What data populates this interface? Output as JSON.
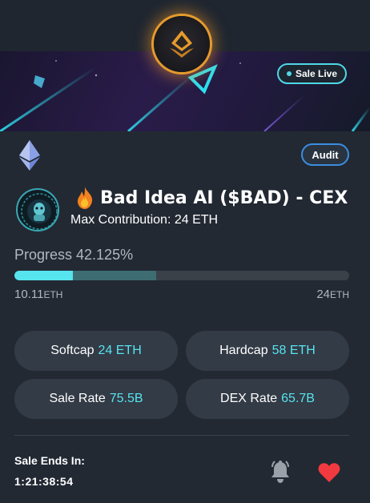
{
  "header": {
    "status_badge": "Sale Live",
    "audit_label": "Audit"
  },
  "project": {
    "title": "Bad Idea AI ($BAD) - CEX",
    "max_contribution": "Max Contribution: 24 ETH",
    "chain_icon": "ethereum-icon",
    "emoji_icon": "fire-icon"
  },
  "progress": {
    "label": "Progress 42.125%",
    "fraction": 0.42125,
    "softcap_fraction": 0.4234,
    "raised_value": "10.11",
    "raised_unit": "ETH",
    "target_value": "24",
    "target_unit": "ETH"
  },
  "stats": {
    "softcap": {
      "label": "Softcap",
      "value": "24 ETH"
    },
    "hardcap": {
      "label": "Hardcap",
      "value": "58 ETH"
    },
    "sale_rate": {
      "label": "Sale Rate",
      "value": "75.5B"
    },
    "dex_rate": {
      "label": "DEX Rate",
      "value": "65.7B"
    }
  },
  "footer": {
    "ends_label": "Sale Ends In:",
    "countdown": "1:21:38:54",
    "bell_icon": "bell-icon",
    "heart_icon": "heart-icon"
  },
  "colors": {
    "accent": "#56e4ef",
    "audit_border": "#3b8de0",
    "heart": "#f03a3f",
    "logo_glow": "#e59b2c"
  }
}
